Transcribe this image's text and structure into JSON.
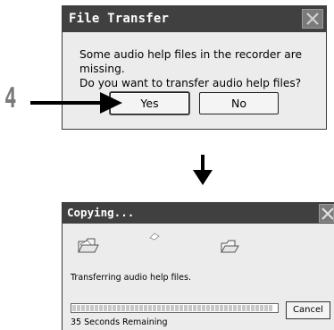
{
  "file_transfer": {
    "title": "File Transfer",
    "message_line1": "Some audio help files in the recorder are missing.",
    "message_line2": "Do you want to transfer audio help files?",
    "yes_label": "Yes",
    "no_label": "No"
  },
  "step_number": "4",
  "copying": {
    "title": "Copying...",
    "status_text": "Transferring audio help files.",
    "progress_fraction": 0.98,
    "cancel_label": "Cancel",
    "time_remaining": "35 Seconds Remaining"
  }
}
